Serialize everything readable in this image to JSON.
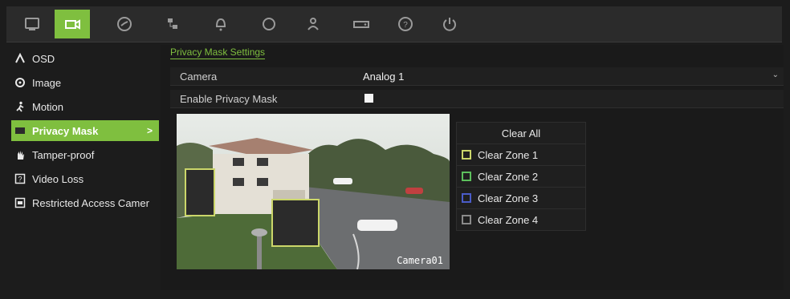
{
  "toolbar": {
    "icons": [
      {
        "name": "display-icon"
      },
      {
        "name": "camera-icon"
      },
      {
        "name": "record-icon"
      },
      {
        "name": "network-icon"
      },
      {
        "name": "alarm-icon"
      },
      {
        "name": "device-icon"
      },
      {
        "name": "user-icon"
      },
      {
        "name": "hdd-icon"
      },
      {
        "name": "help-icon"
      },
      {
        "name": "power-icon"
      }
    ],
    "active": "camera-icon"
  },
  "sidebar": {
    "items": [
      {
        "label": "OSD",
        "icon": "osd-icon"
      },
      {
        "label": "Image",
        "icon": "image-icon"
      },
      {
        "label": "Motion",
        "icon": "motion-icon"
      },
      {
        "label": "Privacy Mask",
        "icon": "privacy-mask-icon",
        "chevron": ">"
      },
      {
        "label": "Tamper-proof",
        "icon": "tamper-icon"
      },
      {
        "label": "Video Loss",
        "icon": "video-loss-icon"
      },
      {
        "label": "Restricted Access Camer",
        "icon": "restricted-icon"
      }
    ],
    "active_index": 3
  },
  "main": {
    "title": "Privacy Mask Settings",
    "camera_label": "Camera",
    "camera_value": "Analog 1",
    "enable_label": "Enable Privacy Mask",
    "enable_checked": true,
    "preview_label": "Camera01",
    "clear_all": "Clear All",
    "zones": [
      {
        "label": "Clear Zone 1",
        "color": "#cbd66a"
      },
      {
        "label": "Clear Zone 2",
        "color": "#5cbf5c"
      },
      {
        "label": "Clear Zone 3",
        "color": "#4a5cc8"
      },
      {
        "label": "Clear Zone 4",
        "color": "#8a8a8a"
      }
    ]
  },
  "colors": {
    "accent": "#7fbf3f",
    "background": "#1c1c1c"
  }
}
